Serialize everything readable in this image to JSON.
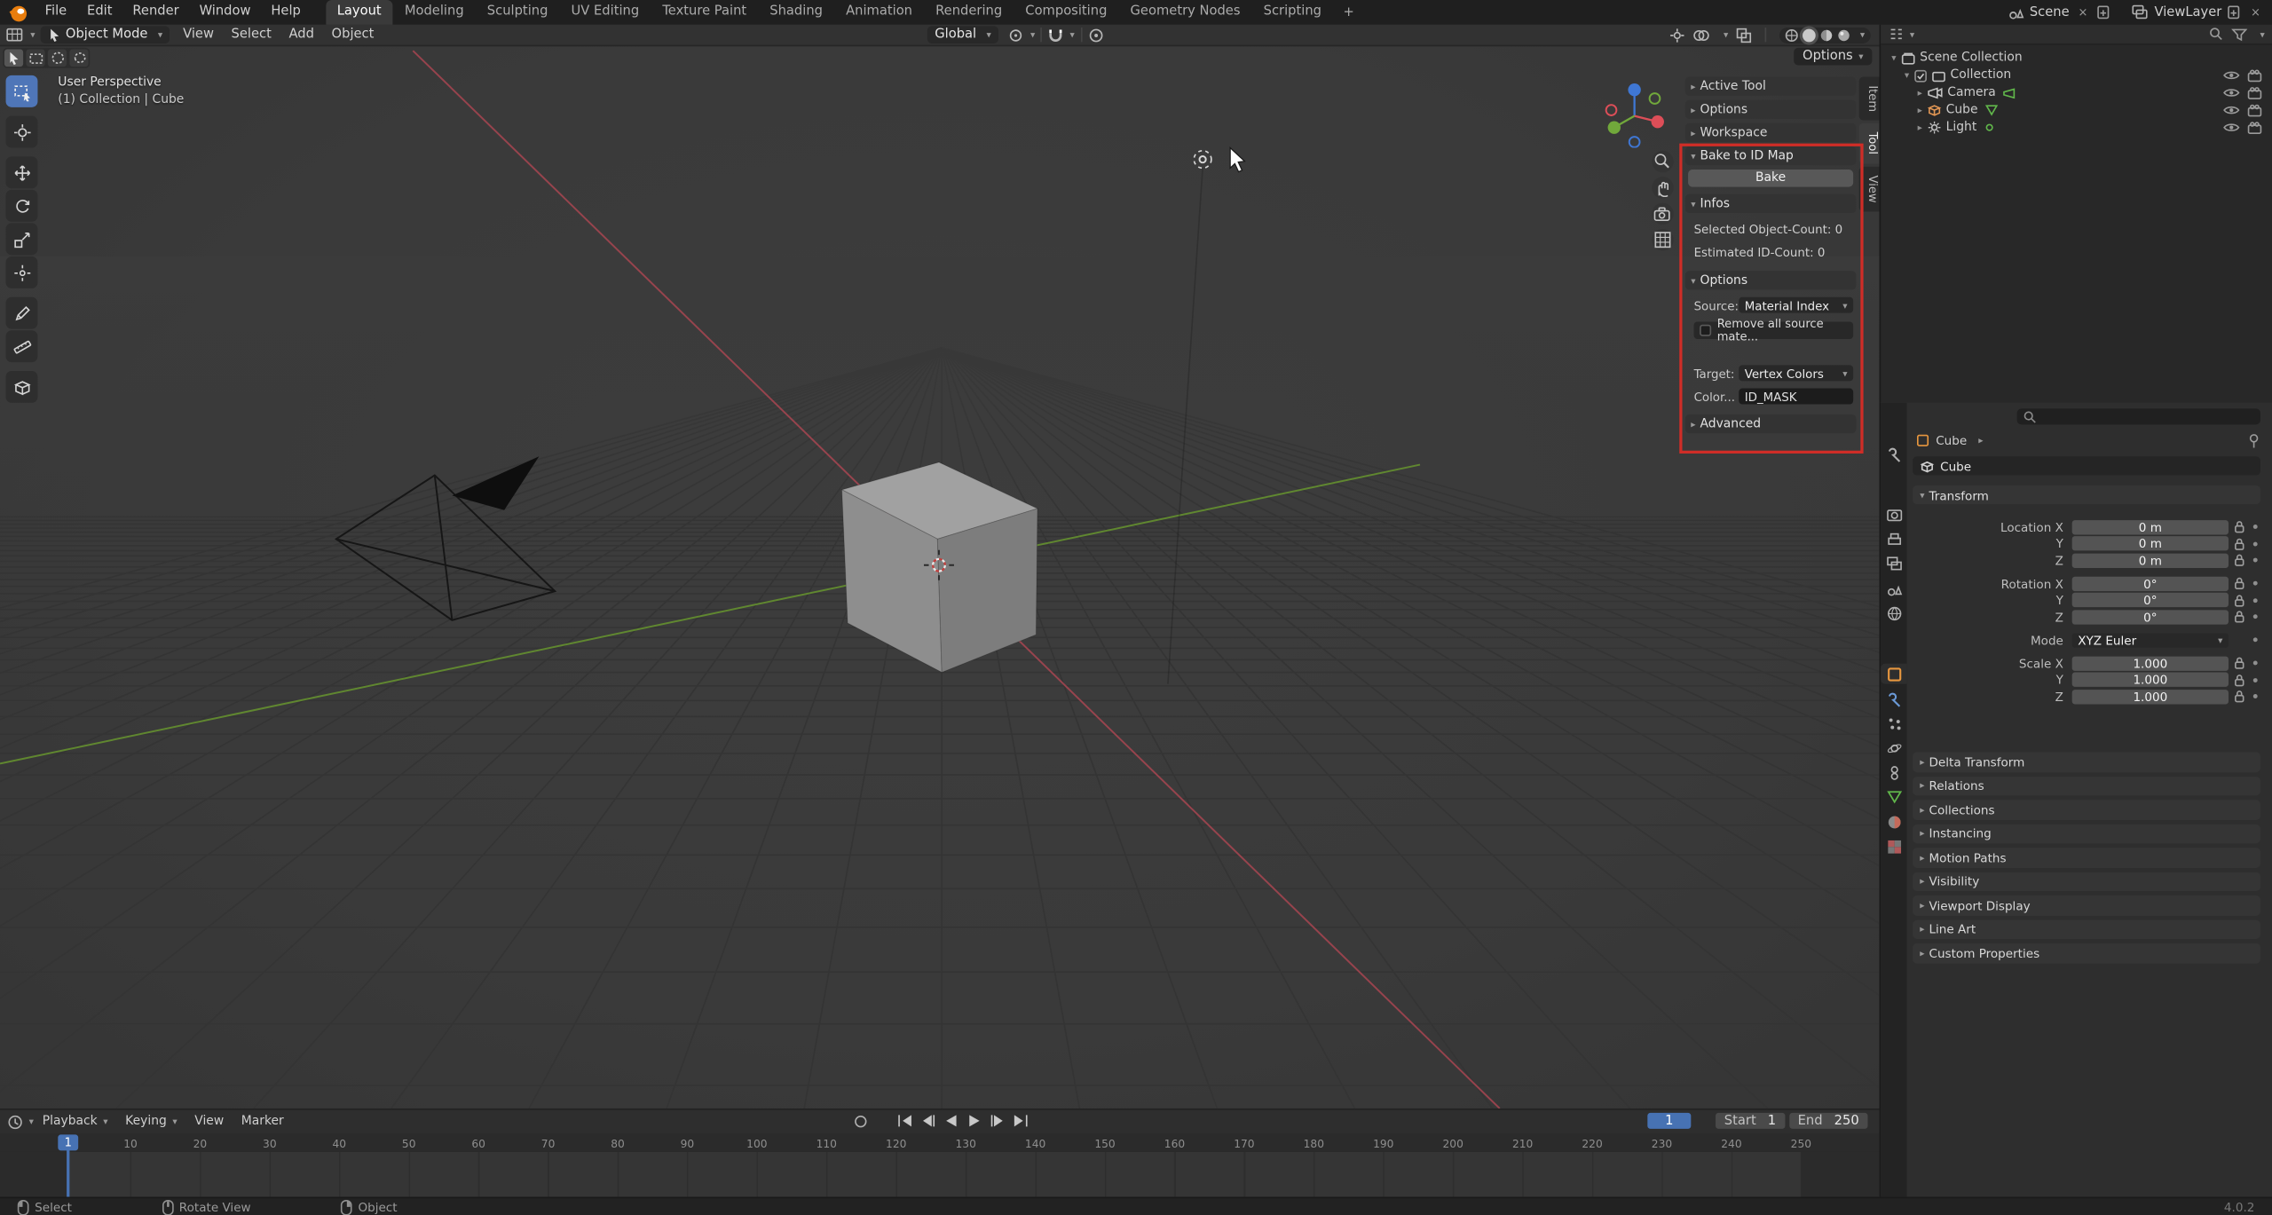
{
  "topbar": {
    "menus": [
      "File",
      "Edit",
      "Render",
      "Window",
      "Help"
    ],
    "workspaces": [
      "Layout",
      "Modeling",
      "Sculpting",
      "UV Editing",
      "Texture Paint",
      "Shading",
      "Animation",
      "Rendering",
      "Compositing",
      "Geometry Nodes",
      "Scripting"
    ],
    "active_workspace": "Layout",
    "add_workspace": "+",
    "scene": {
      "label": "Scene"
    },
    "viewlayer": {
      "label": "ViewLayer"
    }
  },
  "viewport_header": {
    "mode": "Object Mode",
    "menus": [
      "View",
      "Select",
      "Add",
      "Object"
    ],
    "orientation": "Global",
    "options_button": "Options"
  },
  "viewport": {
    "perspective_label": "User Perspective",
    "context_label": "(1) Collection | Cube"
  },
  "sidebar": {
    "tabs": [
      "Item",
      "Tool",
      "View"
    ],
    "active_tab": "Tool",
    "sections": [
      "Active Tool",
      "Options",
      "Workspace"
    ],
    "bake": {
      "title": "Bake to ID Map",
      "bake_button": "Bake",
      "infos_title": "Infos",
      "selected_count": "Selected Object-Count: 0",
      "estimated_count": "Estimated ID-Count: 0",
      "options_title": "Options",
      "source_label": "Source:",
      "source_value": "Material Index",
      "remove_checkbox": "Remove all source mate...",
      "target_label": "Target:",
      "target_value": "Vertex Colors",
      "color_label": "Color...",
      "color_value": "ID_MASK",
      "advanced_title": "Advanced"
    }
  },
  "outliner": {
    "scene_collection": "Scene Collection",
    "collection": "Collection",
    "objects": [
      "Camera",
      "Cube",
      "Light"
    ]
  },
  "properties": {
    "breadcrumb": "Cube",
    "object_name": "Cube",
    "transform_title": "Transform",
    "rows": [
      {
        "label": "Location X",
        "value": "0 m"
      },
      {
        "label": "Y",
        "value": "0 m"
      },
      {
        "label": "Z",
        "value": "0 m"
      },
      {
        "label": "Rotation X",
        "value": "0°"
      },
      {
        "label": "Y",
        "value": "0°"
      },
      {
        "label": "Z",
        "value": "0°"
      },
      {
        "label": "Scale X",
        "value": "1.000"
      },
      {
        "label": "Y",
        "value": "1.000"
      },
      {
        "label": "Z",
        "value": "1.000"
      }
    ],
    "mode_label": "Mode",
    "mode_value": "XYZ Euler",
    "sections": [
      "Delta Transform",
      "Relations",
      "Collections",
      "Instancing",
      "Motion Paths",
      "Visibility",
      "Viewport Display",
      "Line Art",
      "Custom Properties"
    ]
  },
  "timeline": {
    "menus": [
      "Playback",
      "Keying",
      "View",
      "Marker"
    ],
    "current_frame": "1",
    "start_label": "Start",
    "start_value": "1",
    "end_label": "End",
    "end_value": "250",
    "ticks": [
      10,
      20,
      30,
      40,
      50,
      60,
      70,
      80,
      90,
      100,
      110,
      120,
      130,
      140,
      150,
      160,
      170,
      180,
      190,
      200,
      210,
      220,
      230,
      240,
      250
    ]
  },
  "statusbar": {
    "items": [
      "Select",
      "Rotate View",
      "Object"
    ],
    "version": "4.0.2"
  },
  "colors": {
    "accent": "#4772b3",
    "highlight_border": "#cf2d27",
    "axis_x": "#a24550",
    "axis_y": "#6a9b2e"
  }
}
